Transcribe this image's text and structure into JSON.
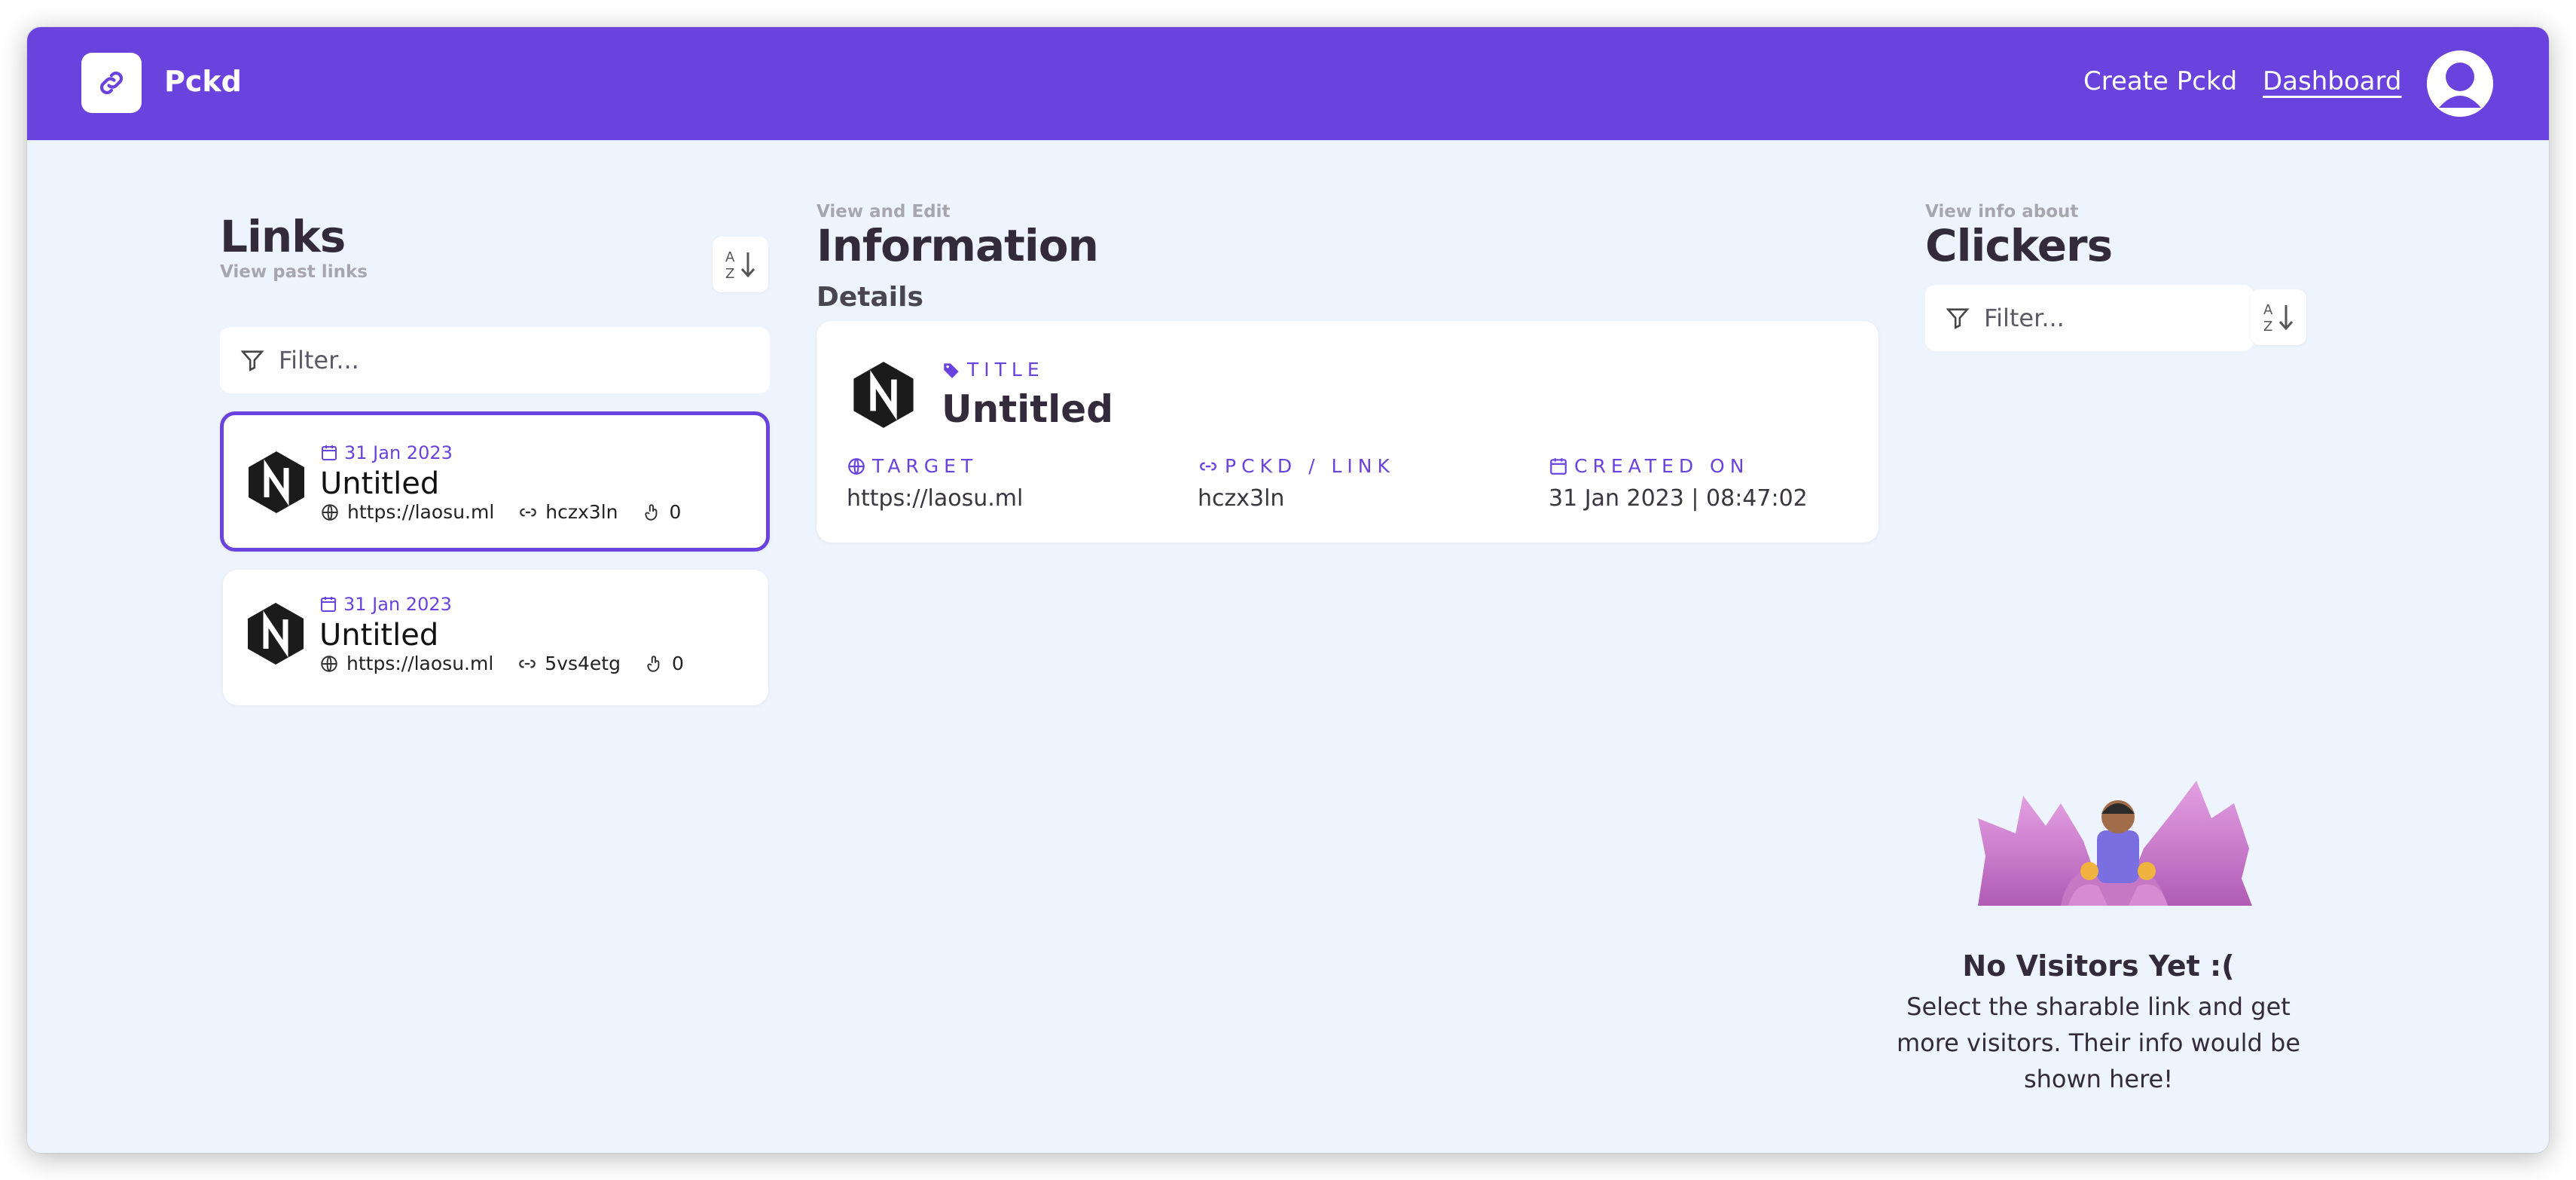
{
  "navbar": {
    "brand": "Pckd",
    "create_link": "Create Pckd",
    "dashboard_link": "Dashboard",
    "icons": {
      "logo": "link-icon",
      "avatar": "user-icon"
    }
  },
  "links_panel": {
    "title": "Links",
    "subtitle": "View past links",
    "sort_icon": "sort-az-icon",
    "filter_placeholder": "Filter...",
    "items": [
      {
        "date": "31 Jan 2023",
        "title": "Untitled",
        "target": "https://laosu.ml",
        "code": "hczx3ln",
        "clicks": "0",
        "selected": true
      },
      {
        "date": "31 Jan 2023",
        "title": "Untitled",
        "target": "https://laosu.ml",
        "code": "5vs4etg",
        "clicks": "0",
        "selected": false
      }
    ]
  },
  "info_panel": {
    "kicker": "View and Edit",
    "title": "Information",
    "section": "Details",
    "card": {
      "title_label": "TITLE",
      "title_value": "Untitled",
      "target_label": "TARGET",
      "target_value": "https://laosu.ml",
      "link_label": "PCKD / LINK",
      "link_value": "hczx3ln",
      "created_label": "CREATED ON",
      "created_value": "31 Jan 2023 | 08:47:02"
    }
  },
  "clickers_panel": {
    "kicker": "View info about",
    "title": "Clickers",
    "filter_placeholder": "Filter...",
    "empty_title": "No Visitors Yet :(",
    "empty_text": "Select the sharable link and get more visitors. Their info would be shown here!"
  },
  "colors": {
    "accent": "#6a42dd",
    "background": "#eef4fd",
    "card": "#ffffff",
    "text": "#332b3b"
  }
}
